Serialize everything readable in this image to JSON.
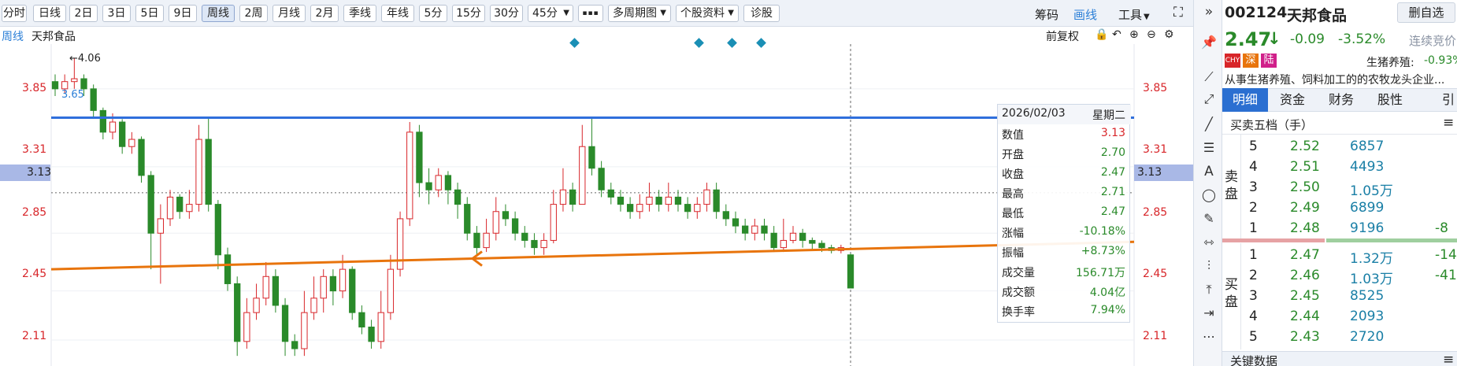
{
  "toolbar": {
    "periods": [
      "分时",
      "日线",
      "2日",
      "3日",
      "5日",
      "9日",
      "周线",
      "2周",
      "月线",
      "2月",
      "季线",
      "年线",
      "5分",
      "15分",
      "30分",
      "45分"
    ],
    "active_period": "周线",
    "more": "▪▪▪",
    "multi_period": "多周期图",
    "stock_info": "个股资料",
    "diagnosis": "诊股",
    "chips": "筹码",
    "draw": "画线",
    "tools": "工具"
  },
  "chart_header": {
    "period_label": "周线",
    "stock_name": "天邦食品",
    "adjust": "前复权"
  },
  "colors": {
    "up": "#d8262a",
    "down": "#2a8a2a",
    "blue_line": "#2f6fdc",
    "orange_line": "#e8740c",
    "accent": "#2b7fd7"
  },
  "chart_data": {
    "type": "candlestick",
    "y_ticks": [
      "3.85",
      "3.31",
      "2.85",
      "2.45",
      "2.11"
    ],
    "y_values": [
      3.85,
      3.31,
      2.85,
      2.45,
      2.11
    ],
    "ylim": [
      1.93,
      4.16
    ],
    "current_price_label": "3.13",
    "high_marker": "←4.06",
    "low_marker": "3.65",
    "candles": [
      [
        3.9,
        3.85,
        3.95,
        3.8
      ],
      [
        3.85,
        3.9,
        3.95,
        3.82
      ],
      [
        3.9,
        3.92,
        4.06,
        3.85
      ],
      [
        3.92,
        3.85,
        3.95,
        3.8
      ],
      [
        3.85,
        3.7,
        3.88,
        3.65
      ],
      [
        3.7,
        3.55,
        3.72,
        3.5
      ],
      [
        3.55,
        3.62,
        3.68,
        3.5
      ],
      [
        3.62,
        3.45,
        3.64,
        3.4
      ],
      [
        3.45,
        3.5,
        3.55,
        3.4
      ],
      [
        3.5,
        3.25,
        3.52,
        3.2
      ],
      [
        3.25,
        2.85,
        3.28,
        2.6
      ],
      [
        2.85,
        2.95,
        3.05,
        2.5
      ],
      [
        2.95,
        3.1,
        3.15,
        2.9
      ],
      [
        3.1,
        3.0,
        3.12,
        2.95
      ],
      [
        3.0,
        3.05,
        3.15,
        2.95
      ],
      [
        3.05,
        3.5,
        3.6,
        3.0
      ],
      [
        3.5,
        3.05,
        3.65,
        3.0
      ],
      [
        3.05,
        2.7,
        3.08,
        2.6
      ],
      [
        2.7,
        2.5,
        2.75,
        2.45
      ],
      [
        2.5,
        2.1,
        2.55,
        2.0
      ],
      [
        2.1,
        2.3,
        2.4,
        2.05
      ],
      [
        2.3,
        2.4,
        2.5,
        2.25
      ],
      [
        2.4,
        2.55,
        2.65,
        2.35
      ],
      [
        2.55,
        2.35,
        2.6,
        2.3
      ],
      [
        2.35,
        2.1,
        2.4,
        2.0
      ],
      [
        2.1,
        2.05,
        2.15,
        2.0
      ],
      [
        2.05,
        2.3,
        2.45,
        2.0
      ],
      [
        2.3,
        2.4,
        2.55,
        2.25
      ],
      [
        2.4,
        2.55,
        2.6,
        2.3
      ],
      [
        2.55,
        2.45,
        2.6,
        2.35
      ],
      [
        2.45,
        2.6,
        2.7,
        2.4
      ],
      [
        2.6,
        2.3,
        2.62,
        2.25
      ],
      [
        2.3,
        2.2,
        2.35,
        2.15
      ],
      [
        2.2,
        2.1,
        2.25,
        2.05
      ],
      [
        2.1,
        2.3,
        2.45,
        2.05
      ],
      [
        2.3,
        2.6,
        2.7,
        2.25
      ],
      [
        2.6,
        2.95,
        3.0,
        2.55
      ],
      [
        2.95,
        3.55,
        3.62,
        2.9
      ],
      [
        3.55,
        3.2,
        3.6,
        3.1
      ],
      [
        3.2,
        3.15,
        3.3,
        3.05
      ],
      [
        3.15,
        3.25,
        3.3,
        3.1
      ],
      [
        3.25,
        3.15,
        3.28,
        3.05
      ],
      [
        3.15,
        3.05,
        3.2,
        2.95
      ],
      [
        3.05,
        2.85,
        3.1,
        2.8
      ],
      [
        2.85,
        2.75,
        2.9,
        2.7
      ],
      [
        2.75,
        2.85,
        2.95,
        2.72
      ],
      [
        2.85,
        3.0,
        3.1,
        2.8
      ],
      [
        3.0,
        2.95,
        3.05,
        2.9
      ],
      [
        2.95,
        2.85,
        3.0,
        2.8
      ],
      [
        2.85,
        2.8,
        2.9,
        2.75
      ],
      [
        2.8,
        2.75,
        2.85,
        2.7
      ],
      [
        2.75,
        2.8,
        2.85,
        2.7
      ],
      [
        2.8,
        3.05,
        3.15,
        2.78
      ],
      [
        3.05,
        3.15,
        3.3,
        3.0
      ],
      [
        3.15,
        3.05,
        3.2,
        3.0
      ],
      [
        3.05,
        3.45,
        3.6,
        3.05
      ],
      [
        3.45,
        3.3,
        3.65,
        3.25
      ],
      [
        3.3,
        3.15,
        3.35,
        3.1
      ],
      [
        3.15,
        3.1,
        3.2,
        3.05
      ],
      [
        3.1,
        3.05,
        3.15,
        3.0
      ],
      [
        3.05,
        3.0,
        3.1,
        2.95
      ],
      [
        3.0,
        3.05,
        3.12,
        2.95
      ],
      [
        3.05,
        3.1,
        3.2,
        3.0
      ],
      [
        3.1,
        3.05,
        3.15,
        3.0
      ],
      [
        3.05,
        3.1,
        3.2,
        3.0
      ],
      [
        3.1,
        3.05,
        3.15,
        3.0
      ],
      [
        3.05,
        3.0,
        3.1,
        2.95
      ],
      [
        3.0,
        3.05,
        3.1,
        2.95
      ],
      [
        3.05,
        3.15,
        3.2,
        3.0
      ],
      [
        3.15,
        3.0,
        3.2,
        2.95
      ],
      [
        3.0,
        2.95,
        3.05,
        2.9
      ],
      [
        2.95,
        2.9,
        3.0,
        2.85
      ],
      [
        2.9,
        2.85,
        2.95,
        2.8
      ],
      [
        2.85,
        2.9,
        2.95,
        2.8
      ],
      [
        2.9,
        2.85,
        2.95,
        2.8
      ],
      [
        2.85,
        2.75,
        2.9,
        2.72
      ],
      [
        2.75,
        2.8,
        2.95,
        2.72
      ],
      [
        2.8,
        2.85,
        2.9,
        2.78
      ],
      [
        2.85,
        2.8,
        2.88,
        2.75
      ],
      [
        2.8,
        2.78,
        2.82,
        2.74
      ],
      [
        2.78,
        2.75,
        2.8,
        2.72
      ],
      [
        2.75,
        2.73,
        2.77,
        2.71
      ],
      [
        2.73,
        2.75,
        2.77,
        2.71
      ],
      [
        2.7,
        2.47,
        2.71,
        2.47
      ]
    ],
    "blue_hline": 3.65,
    "orange_trend": [
      2.6,
      2.79
    ]
  },
  "infobox": {
    "date": "2026/02/03",
    "weekday": "星期二",
    "rows": [
      {
        "k": "数值",
        "v": "3.13",
        "c": "#d8262a"
      },
      {
        "k": "开盘",
        "v": "2.70",
        "c": "#2a8a2a"
      },
      {
        "k": "收盘",
        "v": "2.47",
        "c": "#2a8a2a"
      },
      {
        "k": "最高",
        "v": "2.71",
        "c": "#2a8a2a"
      },
      {
        "k": "最低",
        "v": "2.47",
        "c": "#2a8a2a"
      },
      {
        "k": "涨幅",
        "v": "-10.18%",
        "c": "#2a8a2a"
      },
      {
        "k": "振幅",
        "v": "+8.73%",
        "c": "#2a8a2a"
      },
      {
        "k": "成交量",
        "v": "156.71万",
        "c": "#2a8a2a"
      },
      {
        "k": "成交额",
        "v": "4.04亿",
        "c": "#2a8a2a"
      },
      {
        "k": "换手率",
        "v": "7.94%",
        "c": "#2a8a2a"
      }
    ]
  },
  "quote": {
    "code": "002124",
    "name": "天邦食品",
    "remove": "删自选",
    "price": "2.47",
    "arrow": "↓",
    "change": "-0.09",
    "pct": "-3.52%",
    "consecutive": "连续竞价",
    "tag1": "CHY",
    "tag2": "深",
    "tag3": "陆",
    "sector": "生猪养殖:",
    "sector_pct": "-0.93%",
    "desc": "从事生猪养殖、饲料加工的的农牧龙头企业...",
    "tabs": [
      "明细",
      "资金",
      "财务",
      "股性",
      "引"
    ],
    "orderbook_title": "买卖五档（手）",
    "sell_label": "卖盘",
    "buy_label": "买盘",
    "asks": [
      {
        "lvl": "5",
        "price": "2.52",
        "vol": "6857",
        "extra": ""
      },
      {
        "lvl": "4",
        "price": "2.51",
        "vol": "4493",
        "extra": ""
      },
      {
        "lvl": "3",
        "price": "2.50",
        "vol": "1.05万",
        "extra": ""
      },
      {
        "lvl": "2",
        "price": "2.49",
        "vol": "6899",
        "extra": ""
      },
      {
        "lvl": "1",
        "price": "2.48",
        "vol": "9196",
        "extra": "-8"
      }
    ],
    "bids": [
      {
        "lvl": "1",
        "price": "2.47",
        "vol": "1.32万",
        "extra": "-14"
      },
      {
        "lvl": "2",
        "price": "2.46",
        "vol": "1.03万",
        "extra": "-41"
      },
      {
        "lvl": "3",
        "price": "2.45",
        "vol": "8525",
        "extra": ""
      },
      {
        "lvl": "4",
        "price": "2.44",
        "vol": "2093",
        "extra": ""
      },
      {
        "lvl": "5",
        "price": "2.43",
        "vol": "2720",
        "extra": ""
      }
    ],
    "key_data": "关键数据"
  }
}
